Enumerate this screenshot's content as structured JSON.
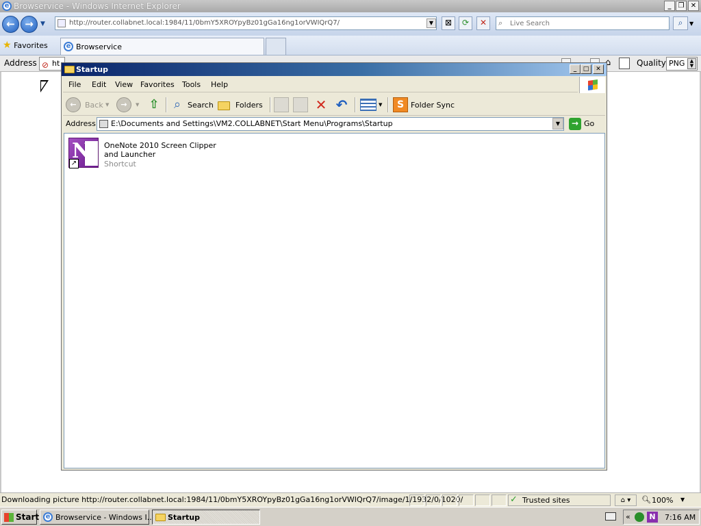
{
  "ie": {
    "title": "Browservice - Windows Internet Explorer",
    "url": "http://router.collabnet.local:1984/11/0bmY5XROYpyBz01gGa16ng1orVWIQrQ7/",
    "search_placeholder": "Live Search",
    "favorites_label": "Favorites",
    "tab_label": "Browservice",
    "inner_toolbar": {
      "address_label": "Address",
      "address_value": "ht",
      "quality_label": "Quality",
      "quality_value": "PNG"
    },
    "status": {
      "text": "Downloading picture http://router.collabnet.local:1984/11/0bmY5XROYpyBz01gGa16ng1orVWIQrQ7/image/1/1932/0/1020/",
      "zone": "Trusted sites",
      "zoom": "100%"
    }
  },
  "explorer": {
    "title": "Startup",
    "menu": [
      "File",
      "Edit",
      "View",
      "Favorites",
      "Tools",
      "Help"
    ],
    "toolbar": {
      "back": "Back",
      "search": "Search",
      "folders": "Folders",
      "folder_sync": "Folder Sync"
    },
    "address_label": "Address",
    "address_path": "E:\\Documents and Settings\\VM2.COLLABNET\\Start Menu\\Programs\\Startup",
    "go_label": "Go",
    "files": [
      {
        "name": "OneNote 2010 Screen Clipper and Launcher",
        "type": "Shortcut",
        "icon": "onenote-icon"
      }
    ]
  },
  "taskbar": {
    "start_label": "Start",
    "items": [
      "Browservice - Windows I...",
      "Startup"
    ],
    "clock": "7:16 AM"
  },
  "colors": {
    "explorer_title_start": "#0a246a",
    "explorer_title_end": "#a6caf0",
    "onenote_purple": "#8a2fae"
  }
}
